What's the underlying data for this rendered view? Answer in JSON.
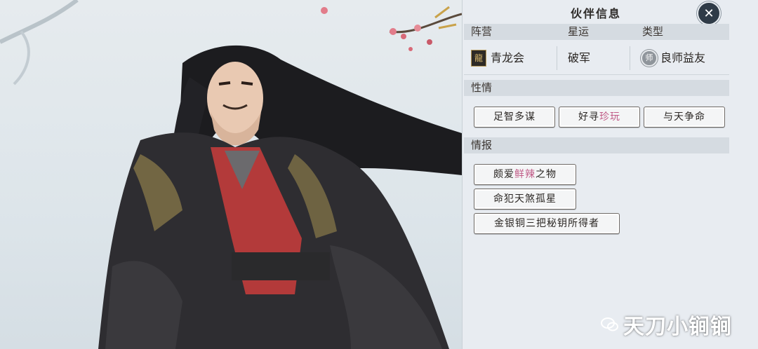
{
  "panel": {
    "title": "伙伴信息",
    "close_icon": "close-icon"
  },
  "info_header": {
    "faction_label": "阵营",
    "fate_label": "星运",
    "type_label": "类型"
  },
  "info_values": {
    "faction": "青龙会",
    "faction_icon": "dragon-emblem-icon",
    "fate": "破军",
    "type": "良师益友",
    "type_icon": "mentor-badge-icon"
  },
  "temperament": {
    "label": "性情",
    "tags": [
      {
        "parts": [
          "足智多谋"
        ]
      },
      {
        "parts": [
          "好寻",
          "珍玩"
        ]
      },
      {
        "parts": [
          "与天争命"
        ]
      }
    ]
  },
  "intel": {
    "label": "情报",
    "tags": [
      {
        "parts": [
          "颇爱",
          "鲜辣",
          "之物"
        ]
      },
      {
        "parts": [
          "命犯天煞孤星"
        ]
      },
      {
        "parts": [
          "金银铜三把秘钥所得者"
        ]
      }
    ]
  },
  "colors": {
    "highlight": "#c05a86",
    "panel_bg": "#e8ecf0",
    "section_bg": "#d5dbe1",
    "close_bg": "#2f3b47"
  },
  "watermark": {
    "text": "天刀小锏锏",
    "icon": "wechat-icon"
  }
}
